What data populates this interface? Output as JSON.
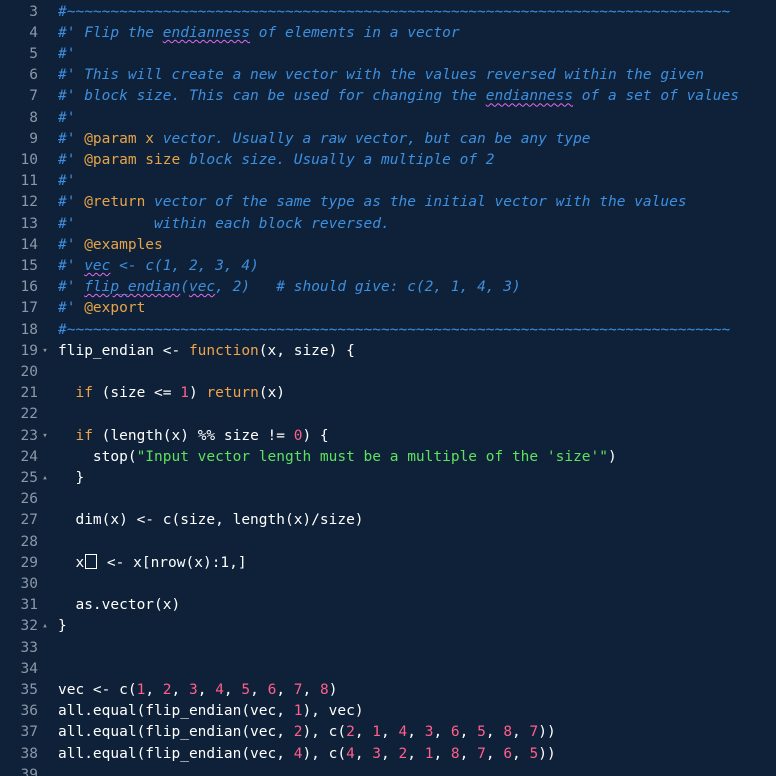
{
  "editor": {
    "background": "#0f2138",
    "colors": {
      "comment": "#3d8fe0",
      "roxygen_tag": "#e6a44a",
      "keyword": "#f1a34b",
      "number": "#ff5f8a",
      "string": "#5ee15e",
      "line_number": "#8c97a8"
    },
    "lines": [
      {
        "n": "3",
        "fold": ""
      },
      {
        "n": "4",
        "fold": ""
      },
      {
        "n": "5",
        "fold": ""
      },
      {
        "n": "6",
        "fold": ""
      },
      {
        "n": "7",
        "fold": ""
      },
      {
        "n": "8",
        "fold": ""
      },
      {
        "n": "9",
        "fold": ""
      },
      {
        "n": "10",
        "fold": ""
      },
      {
        "n": "11",
        "fold": ""
      },
      {
        "n": "12",
        "fold": ""
      },
      {
        "n": "13",
        "fold": ""
      },
      {
        "n": "14",
        "fold": ""
      },
      {
        "n": "15",
        "fold": ""
      },
      {
        "n": "16",
        "fold": ""
      },
      {
        "n": "17",
        "fold": ""
      },
      {
        "n": "18",
        "fold": ""
      },
      {
        "n": "19",
        "fold": "▾"
      },
      {
        "n": "20",
        "fold": ""
      },
      {
        "n": "21",
        "fold": ""
      },
      {
        "n": "22",
        "fold": ""
      },
      {
        "n": "23",
        "fold": "▾"
      },
      {
        "n": "24",
        "fold": ""
      },
      {
        "n": "25",
        "fold": "▴"
      },
      {
        "n": "26",
        "fold": ""
      },
      {
        "n": "27",
        "fold": ""
      },
      {
        "n": "28",
        "fold": ""
      },
      {
        "n": "29",
        "fold": ""
      },
      {
        "n": "30",
        "fold": ""
      },
      {
        "n": "31",
        "fold": ""
      },
      {
        "n": "32",
        "fold": "▴"
      },
      {
        "n": "33",
        "fold": ""
      },
      {
        "n": "34",
        "fold": ""
      },
      {
        "n": "35",
        "fold": ""
      },
      {
        "n": "36",
        "fold": ""
      },
      {
        "n": "37",
        "fold": ""
      },
      {
        "n": "38",
        "fold": ""
      },
      {
        "n": "39",
        "fold": ""
      }
    ],
    "code": {
      "l3": "#~~~~~~~~~~~~~~~~~~~~~~~~~~~~~~~~~~~~~~~~~~~~~~~~~~~~~~~~~~~~~~~~~~~~~~~~~~~~",
      "l4a": "#' Flip the ",
      "l4b": "endianness",
      "l4c": " of elements in a vector",
      "l5": "#'",
      "l6": "#' This will create a new vector with the values reversed within the given",
      "l7a": "#' block size. This can be used for changing the ",
      "l7b": "endianness",
      "l7c": " of a set of values",
      "l8": "#'",
      "l9a": "#' ",
      "l9b": "@param x",
      "l9c": " vector. Usually a raw vector, but can be any type",
      "l10a": "#' ",
      "l10b": "@param size",
      "l10c": " block size. Usually a multiple of 2",
      "l11": "#'",
      "l12a": "#' ",
      "l12b": "@return",
      "l12c": " vector of the same type as the initial vector with the values",
      "l13": "#'         within each block reversed.",
      "l14a": "#' ",
      "l14b": "@examples",
      "l15a": "#' ",
      "l15b": "vec",
      "l15c": " <- c(1, 2, 3, 4)",
      "l16a": "#' ",
      "l16b": "flip_endian",
      "l16c": "(",
      "l16d": "vec",
      "l16e": ", 2)   # should give: c(2, 1, 4, 3)",
      "l17a": "#' ",
      "l17b": "@export",
      "l18": "#~~~~~~~~~~~~~~~~~~~~~~~~~~~~~~~~~~~~~~~~~~~~~~~~~~~~~~~~~~~~~~~~~~~~~~~~~~~~",
      "l19a": "flip_endian <- ",
      "l19b": "function",
      "l19c": "(x, size) {",
      "l21a": "  ",
      "l21b": "if",
      "l21c": " (size <= ",
      "l21d": "1",
      "l21e": ") ",
      "l21f": "return",
      "l21g": "(x)",
      "l23a": "  ",
      "l23b": "if",
      "l23c": " (length(x) %% size != ",
      "l23d": "0",
      "l23e": ") {",
      "l24a": "    stop(",
      "l24b": "\"Input vector length must be a multiple of the 'size'\"",
      "l24c": ")",
      "l25": "  }",
      "l27": "  dim(x) <- c(size, length(x)/size)",
      "l29a": "  x",
      "l29b": " <- x[nrow(x):1,]",
      "l31": "  as.vector(x)",
      "l32": "}",
      "l35a": "vec <- c(",
      "l35nums": [
        "1",
        "2",
        "3",
        "4",
        "5",
        "6",
        "7",
        "8"
      ],
      "l36a": "all.equal(flip_endian(vec, ",
      "l36b": "1",
      "l36c": "), vec)",
      "l37a": "all.equal(flip_endian(vec, ",
      "l37b": "2",
      "l37c": "), c(",
      "l37nums": [
        "2",
        "1",
        "4",
        "3",
        "6",
        "5",
        "8",
        "7"
      ],
      "l38a": "all.equal(flip_endian(vec, ",
      "l38b": "4",
      "l38c": "), c(",
      "l38nums": [
        "4",
        "3",
        "2",
        "1",
        "8",
        "7",
        "6",
        "5"
      ]
    }
  }
}
